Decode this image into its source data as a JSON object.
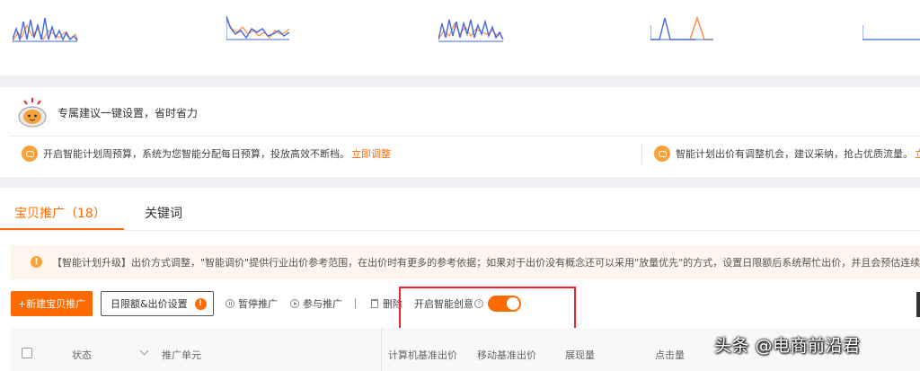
{
  "suggestion": {
    "title": "专属建议一键设置，省时省力",
    "tip1": {
      "text": "开启智能计划周预算，系统为您智能分配每日预算，投放高效不断档。",
      "link": "立即调整"
    },
    "tip2": {
      "text": "智能计划出价有调整机会，建议采纳，抢占优质流量。",
      "link": "立"
    }
  },
  "tabs": [
    {
      "label": "宝贝推广（18）",
      "active": true
    },
    {
      "label": "关键词",
      "active": false
    }
  ],
  "notice": {
    "text": "【智能计划升级】出价方式调整，\"智能调价\"提供行业出价参考范围，在出价时有更多的参考依据；如果对于出价没有概念还可以采用\"放量优先\"的方式，设置日限额后系统帮忙出价，并且会预估连续投放可"
  },
  "toolbar": {
    "new_promo": "+新建宝贝推广",
    "budget_settings": "日限额&出价设置",
    "warn_mark": "!",
    "pause": "暂停推广",
    "join": "参与推广",
    "divider": "|",
    "delete": "删除",
    "smart_creative": "开启智能创意",
    "smart_creative_on": true
  },
  "table": {
    "headers": {
      "status": "状态",
      "unit": "推广单元",
      "pc_bid": "计算机基准出价",
      "mobile_bid": "移动基准出价",
      "impressions": "展现量",
      "clicks": "点击量"
    }
  },
  "watermark": "头条 @电商前沿君",
  "colors": {
    "accent": "#ff6a00",
    "spark_blue": "#4169e1",
    "spark_orange": "#ff8c3a",
    "highlight": "#e8262a"
  }
}
